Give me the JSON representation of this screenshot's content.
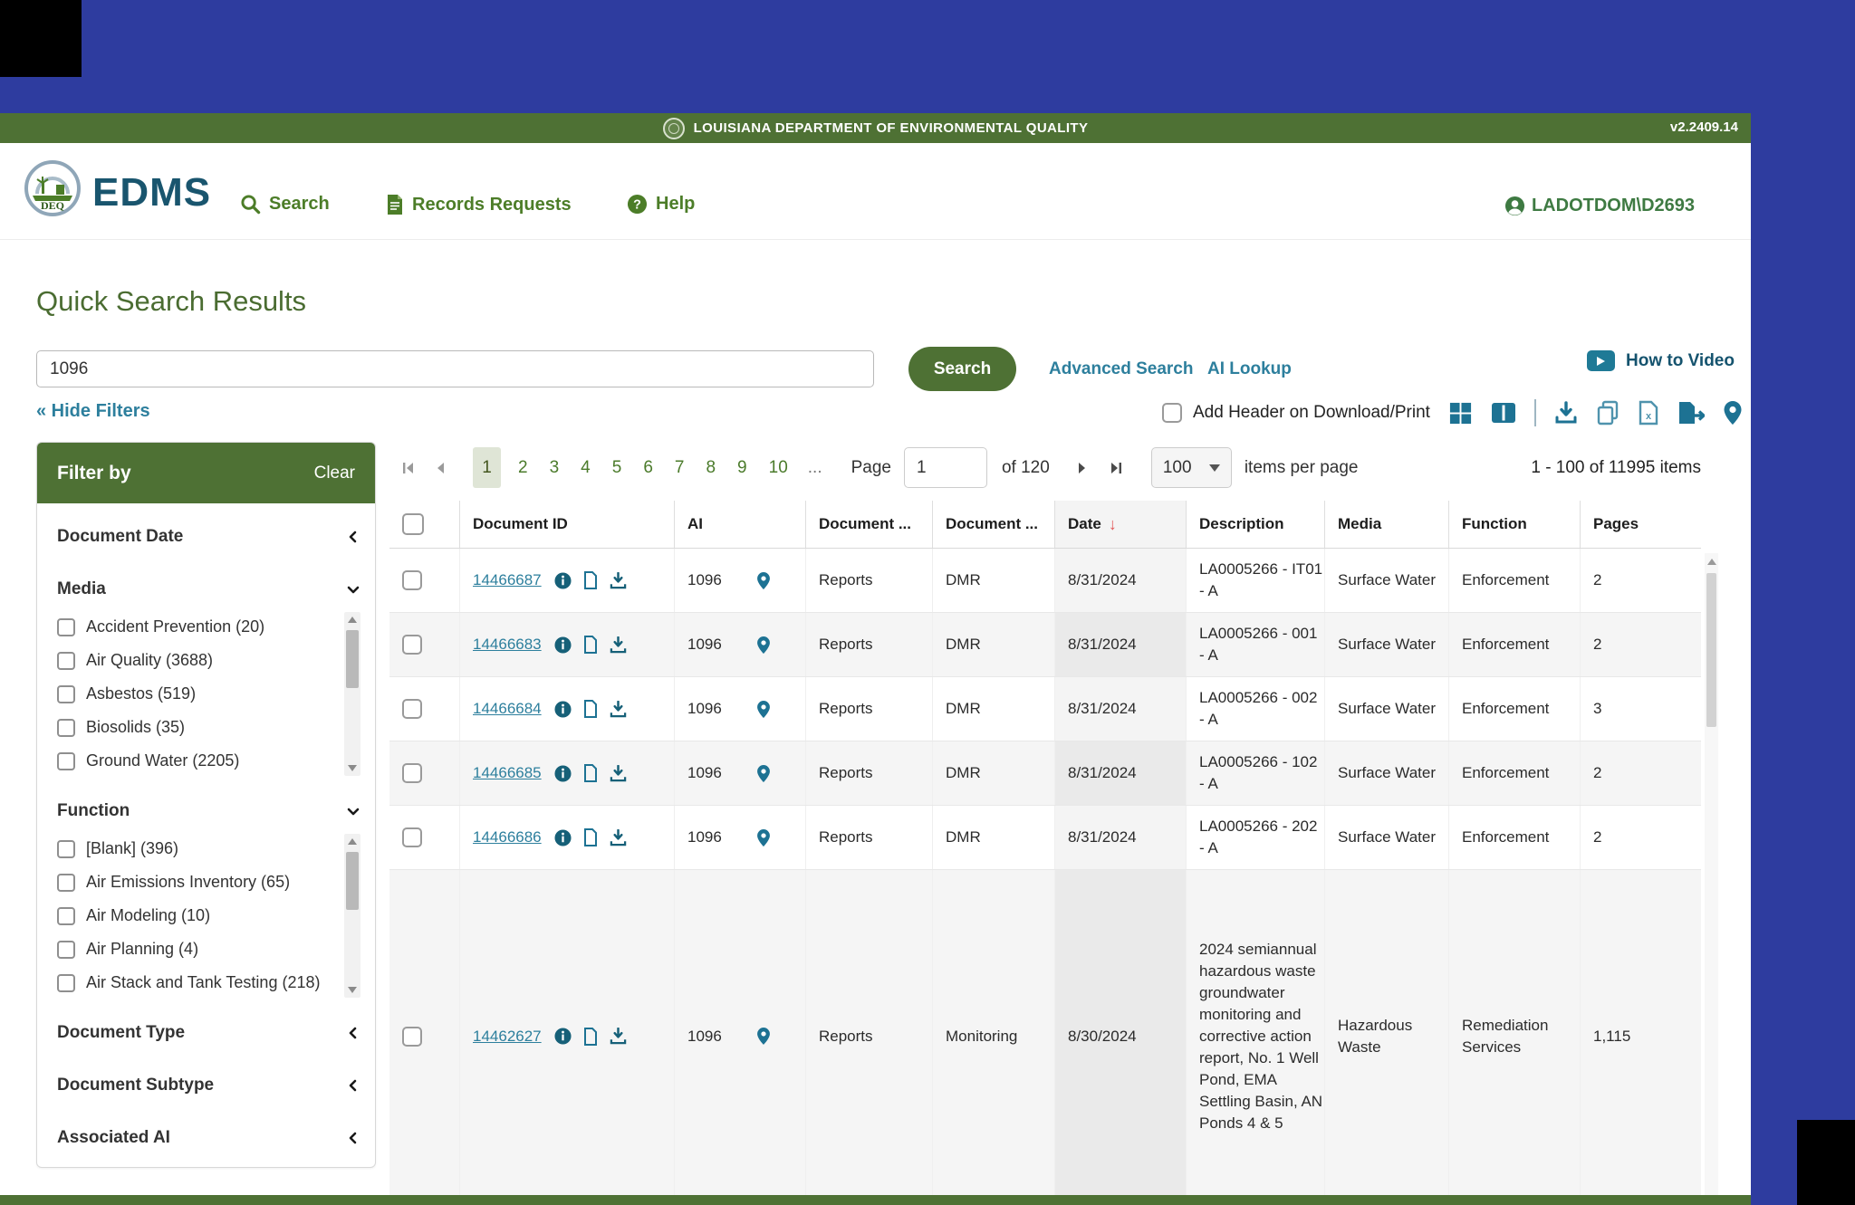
{
  "chrome": {
    "agency": "LOUISIANA DEPARTMENT OF ENVIRONMENTAL QUALITY",
    "version": "v2.2409.14"
  },
  "header": {
    "brand": "EDMS",
    "nav": [
      {
        "label": "Search"
      },
      {
        "label": "Records Requests"
      },
      {
        "label": "Help"
      }
    ],
    "user": "LADOTDOM\\D2693"
  },
  "search": {
    "title": "Quick Search Results",
    "query": "1096",
    "button": "Search",
    "advanced": "Advanced Search",
    "ai_lookup": "AI Lookup",
    "video": "How to Video",
    "hide_filters": "« Hide Filters",
    "add_header": "Add Header on Download/Print"
  },
  "filters": {
    "title": "Filter by",
    "clear": "Clear",
    "sections": [
      {
        "label": "Document Date",
        "state": "collapsed"
      },
      {
        "label": "Media",
        "state": "expanded",
        "items": [
          {
            "label": "Accident Prevention (20)"
          },
          {
            "label": "Air Quality (3688)"
          },
          {
            "label": "Asbestos (519)"
          },
          {
            "label": "Biosolids (35)"
          },
          {
            "label": "Ground Water (2205)"
          }
        ]
      },
      {
        "label": "Function",
        "state": "expanded",
        "items": [
          {
            "label": "[Blank] (396)"
          },
          {
            "label": "Air Emissions Inventory (65)"
          },
          {
            "label": "Air Modeling (10)"
          },
          {
            "label": "Air Planning (4)"
          },
          {
            "label": "Air Stack and Tank Testing (218)"
          }
        ]
      },
      {
        "label": "Document Type",
        "state": "collapsed"
      },
      {
        "label": "Document Subtype",
        "state": "collapsed"
      },
      {
        "label": "Associated AI",
        "state": "collapsed"
      }
    ]
  },
  "pagination": {
    "pages": [
      "1",
      "2",
      "3",
      "4",
      "5",
      "6",
      "7",
      "8",
      "9",
      "10",
      "..."
    ],
    "current": "1",
    "page_label": "Page",
    "page_value": "1",
    "of_label": "of 120",
    "per_page": "100",
    "per_page_label": "items per page",
    "range": "1 - 100 of 11995 items"
  },
  "table": {
    "columns": [
      "Document ID",
      "AI",
      "Document ...",
      "Document ...",
      "Date",
      "Description",
      "Media",
      "Function",
      "Pages"
    ],
    "rows": [
      {
        "id": "14466687",
        "ai": "1096",
        "doc_type": "Reports",
        "doc_subtype": "DMR",
        "date": "8/31/2024",
        "description": "LA0005266 - IT01 - A",
        "media": "Surface Water",
        "function": "Enforcement",
        "pages": "2"
      },
      {
        "id": "14466683",
        "ai": "1096",
        "doc_type": "Reports",
        "doc_subtype": "DMR",
        "date": "8/31/2024",
        "description": "LA0005266 - 001 - A",
        "media": "Surface Water",
        "function": "Enforcement",
        "pages": "2"
      },
      {
        "id": "14466684",
        "ai": "1096",
        "doc_type": "Reports",
        "doc_subtype": "DMR",
        "date": "8/31/2024",
        "description": "LA0005266 - 002 - A",
        "media": "Surface Water",
        "function": "Enforcement",
        "pages": "3"
      },
      {
        "id": "14466685",
        "ai": "1096",
        "doc_type": "Reports",
        "doc_subtype": "DMR",
        "date": "8/31/2024",
        "description": "LA0005266 - 102 - A",
        "media": "Surface Water",
        "function": "Enforcement",
        "pages": "2"
      },
      {
        "id": "14466686",
        "ai": "1096",
        "doc_type": "Reports",
        "doc_subtype": "DMR",
        "date": "8/31/2024",
        "description": "LA0005266 - 202 - A",
        "media": "Surface Water",
        "function": "Enforcement",
        "pages": "2"
      },
      {
        "id": "14462627",
        "ai": "1096",
        "doc_type": "Reports",
        "doc_subtype": "Monitoring",
        "date": "8/30/2024",
        "description": "2024 semiannual hazardous waste groundwater monitoring and corrective action report, No. 1 Well Pond, EMA Settling Basin, AN Ponds 4 & 5",
        "media": "Hazardous Waste",
        "function": "Remediation Services",
        "pages": "1,115"
      }
    ]
  }
}
